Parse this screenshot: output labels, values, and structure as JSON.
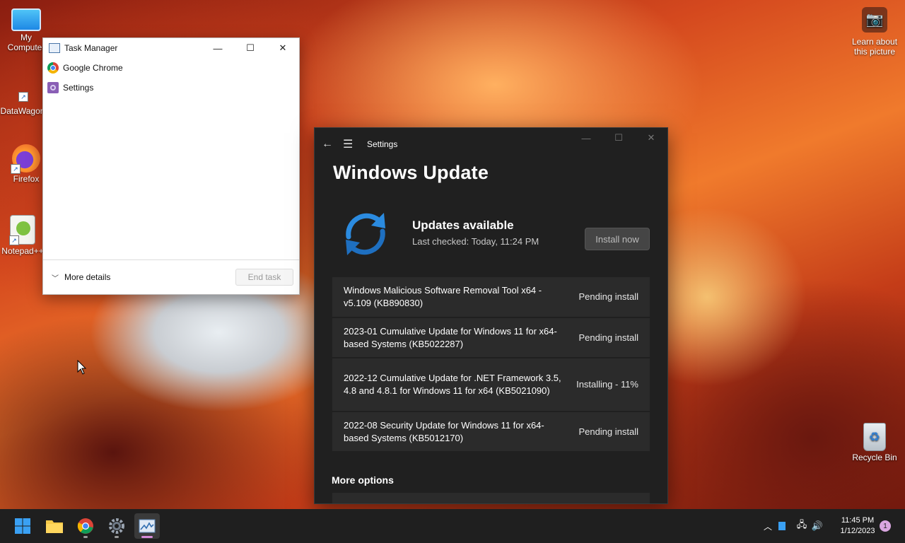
{
  "desktop": {
    "icons": [
      {
        "label": "My Computer"
      },
      {
        "label": "DataWagon"
      },
      {
        "label": "Firefox"
      },
      {
        "label": "Notepad++"
      }
    ],
    "recycle_bin": "Recycle Bin",
    "learn_picture": "Learn about this picture"
  },
  "task_manager": {
    "title": "Task Manager",
    "apps": [
      "Google Chrome",
      "Settings"
    ],
    "more_details": "More details",
    "end_task": "End task"
  },
  "settings": {
    "window_title": "Settings",
    "page_title": "Windows Update",
    "status_title": "Updates available",
    "last_checked": "Last checked: Today, 11:24 PM",
    "install_button": "Install now",
    "updates": [
      {
        "name": "Windows Malicious Software Removal Tool x64 - v5.109 (KB890830)",
        "status": "Pending install"
      },
      {
        "name": "2023-01 Cumulative Update for Windows 11 for x64-based Systems (KB5022287)",
        "status": "Pending install"
      },
      {
        "name": "2022-12 Cumulative Update for .NET Framework 3.5, 4.8 and 4.8.1 for Windows 11 for x64 (KB5021090)",
        "status": "Installing - 11%"
      },
      {
        "name": "2022-08 Security Update for Windows 11 for x64-based Systems (KB5012170)",
        "status": "Pending install"
      }
    ],
    "more_options": "More options"
  },
  "taskbar": {
    "time": "11:45 PM",
    "date": "1/12/2023",
    "notification_count": "1"
  }
}
